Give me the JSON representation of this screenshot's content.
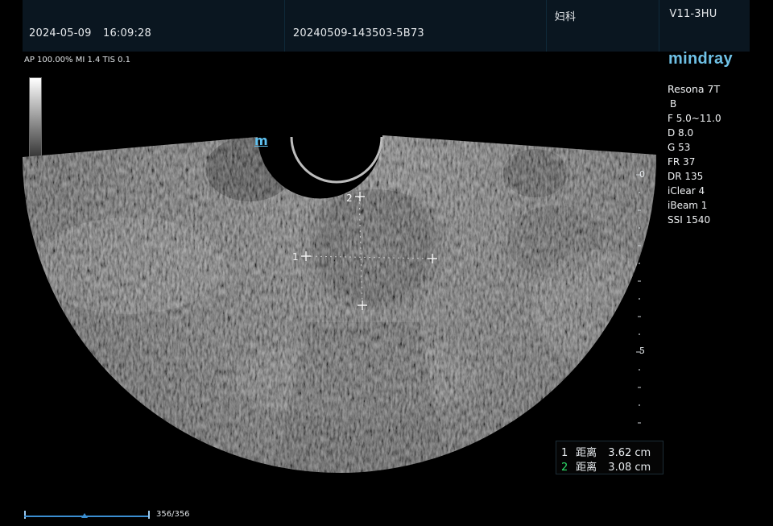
{
  "header": {
    "date": "2024-05-09",
    "time": "16:09:28",
    "exam_id": "20240509-143503-5B73",
    "department": "妇科",
    "probe": "V11-3HU"
  },
  "brand": "mindray",
  "acoustic": "AP 100.00%  MI 1.4 TIS 0.1",
  "params": {
    "model": "Resona 7T",
    "mode": "B",
    "frequency": "F 5.0~11.0",
    "depth": "D 8.0",
    "gain": "G 53",
    "frame_rate": "FR 37",
    "dynamic_range": "DR 135",
    "iclear": "iClear 4",
    "ibeam": "iBeam 1",
    "ssi": "SSI 1540"
  },
  "depth_scale": {
    "top": "0",
    "mid": "5"
  },
  "orientation_mark": "m",
  "markers": {
    "one": "1",
    "two": "2"
  },
  "measurements": [
    {
      "index": "1",
      "label": "距离",
      "value": "3.62 cm"
    },
    {
      "index": "2",
      "label": "距离",
      "value": "3.08 cm"
    }
  ],
  "cine": {
    "frame": "356/356"
  },
  "colors": {
    "accent": "#6fc1e6",
    "header_bg": "#0a1620",
    "measure2": "#2ee06a"
  }
}
